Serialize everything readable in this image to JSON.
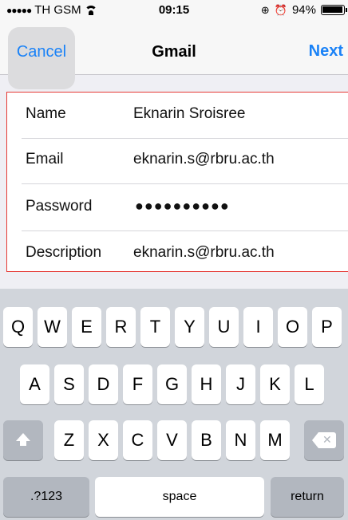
{
  "status_bar": {
    "signal": "●●●●●",
    "carrier": "TH GSM",
    "time": "09:15",
    "battery": "94%"
  },
  "nav": {
    "cancel_label": "Cancel",
    "title": "Gmail",
    "next_label": "Next"
  },
  "form": {
    "rows": [
      {
        "label": "Name",
        "value": "Eknarin Sroisree"
      },
      {
        "label": "Email",
        "value": "eknarin.s@rbru.ac.th"
      },
      {
        "label": "Password",
        "value": "●●●●●●●●●●"
      },
      {
        "label": "Description",
        "value": "eknarin.s@rbru.ac.th"
      }
    ]
  },
  "keyboard": {
    "row1": [
      "Q",
      "W",
      "E",
      "R",
      "T",
      "Y",
      "U",
      "I",
      "O",
      "P"
    ],
    "row2": [
      "A",
      "S",
      "D",
      "F",
      "G",
      "H",
      "J",
      "K",
      "L"
    ],
    "row3": [
      "Z",
      "X",
      "C",
      "V",
      "B",
      "N",
      "M"
    ],
    "numbers_label": ".?123",
    "space_label": "space",
    "return_label": "return"
  },
  "colors": {
    "accent": "#1a82f7",
    "highlight_border": "#e53935",
    "keyboard_bg": "#d1d5db"
  }
}
